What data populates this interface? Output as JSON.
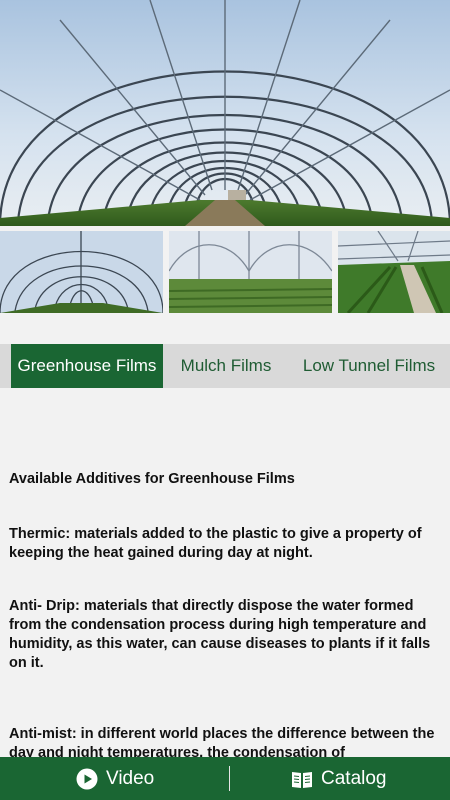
{
  "tabs": [
    {
      "label": "Greenhouse Films",
      "active": true
    },
    {
      "label": "Mulch Films",
      "active": false
    },
    {
      "label": "Low Tunnel Films",
      "active": false
    }
  ],
  "content": {
    "heading": "Available Additives for Greenhouse Films",
    "paragraphs": [
      "Thermic: materials added to the plastic to give a property of keeping the heat gained during day at night.",
      "Anti- Drip:  materials that directly dispose the water formed from the condensation process during high temperature and humidity, as this water, can cause diseases to plants if it falls on it.",
      "Anti-mist: in different world places the difference between the day and night temperatures, the condensation of"
    ]
  },
  "bottom_bar": {
    "video_label": "Video",
    "video_icon": "play-circle-icon",
    "catalog_label": "Catalog",
    "catalog_icon": "book-icon"
  },
  "colors": {
    "brand_green": "#1a6633",
    "tab_bar_bg": "#d9d9d9",
    "page_bg": "#f2f2f2"
  }
}
